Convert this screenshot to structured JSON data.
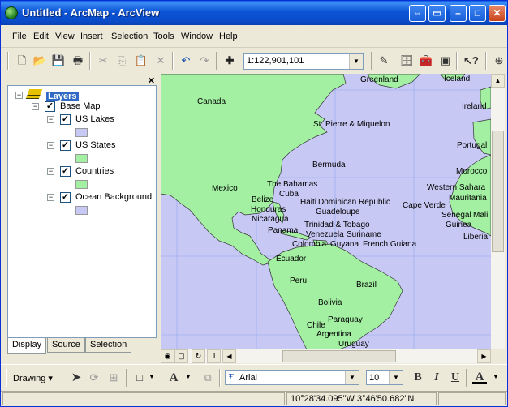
{
  "window": {
    "title": "Untitled - ArcMap - ArcView"
  },
  "menu": [
    "File",
    "Edit",
    "View",
    "Insert",
    "Selection",
    "Tools",
    "Window",
    "Help"
  ],
  "toolbar": {
    "scale": "1:122,901,101"
  },
  "toc": {
    "root": "Layers",
    "group": "Base Map",
    "layers": [
      {
        "name": "US Lakes",
        "color": "#c8c8f5"
      },
      {
        "name": "US States",
        "color": "#a3f0a3"
      },
      {
        "name": "Countries",
        "color": "#a3f0a3"
      },
      {
        "name": "Ocean Background",
        "color": "#c8c8f5"
      }
    ],
    "tabs": [
      "Display",
      "Source",
      "Selection"
    ]
  },
  "map": {
    "ocean_color": "#c8c8f5",
    "land_color": "#a3f0a3",
    "labels": {
      "greenland": "Greenland",
      "iceland": "Iceland",
      "canada": "Canada",
      "ireland": "Ireland",
      "st_pierre": "St. Pierre & Miquelon",
      "portugal": "Portugal",
      "bermuda": "Bermuda",
      "morocco": "Morocco",
      "mexico": "Mexico",
      "the_bahamas": "The Bahamas",
      "cuba": "Cuba",
      "belize": "Belize",
      "haiti": "Haiti",
      "dominican": "Dominican Republic",
      "cape_verde": "Cape Verde",
      "western_sahara": "Western Sahara",
      "mauritania": "Mauritania",
      "honduras": "Honduras",
      "guadeloupe": "Guadeloupe",
      "senegal": "Senegal",
      "mali": "Mali",
      "nicaragua": "Nicaragua",
      "guinea": "Guinea",
      "trinidad": "Trinidad & Tobago",
      "venezuela": "Venezuela",
      "suriname": "Suriname",
      "liberia": "Liberia",
      "panama": "Panama",
      "colombia": "Colombia",
      "guyana": "Guyana",
      "french_guiana": "French Guiana",
      "ecuador": "Ecuador",
      "peru": "Peru",
      "brazil": "Brazil",
      "bolivia": "Bolivia",
      "paraguay": "Paraguay",
      "chile": "Chile",
      "argentina": "Argentina",
      "uruguay": "Uruguay"
    }
  },
  "drawing": {
    "label": "Drawing",
    "font": "Arial",
    "font_size": "10"
  },
  "status": {
    "coordinates": "10°28'34.095\"W  3°46'50.682\"N"
  }
}
